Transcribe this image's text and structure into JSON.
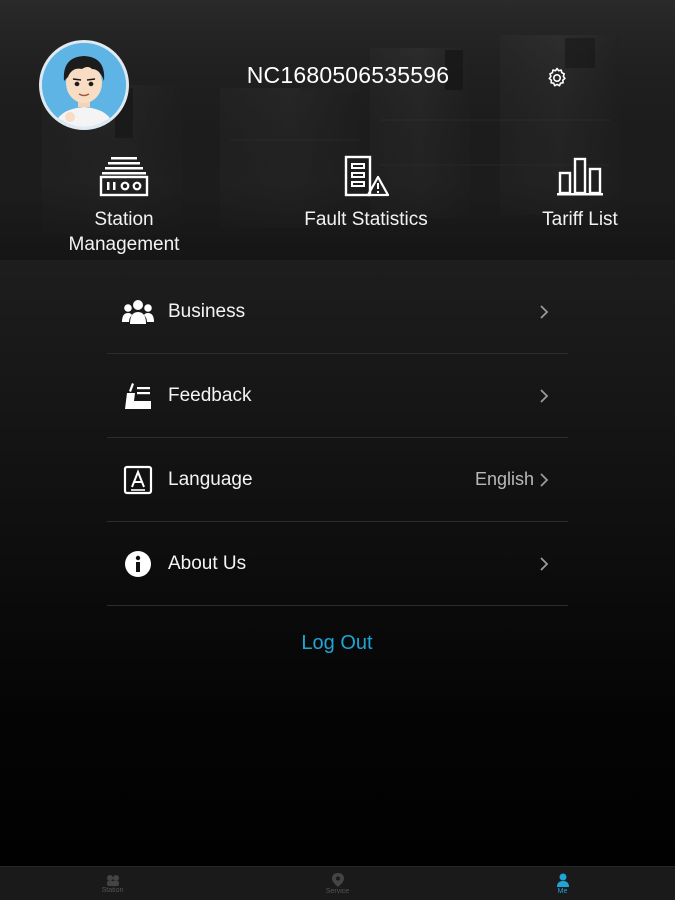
{
  "header": {
    "username": "NC1680506535596",
    "avatar_icon": "avatar-icon",
    "settings_icon": "gear-icon"
  },
  "quick_actions": [
    {
      "label": "Station Management",
      "icon": "station-icon"
    },
    {
      "label": "Fault Statistics",
      "icon": "fault-statistics-icon"
    },
    {
      "label": "Tariff List",
      "icon": "bar-chart-icon"
    }
  ],
  "menu": [
    {
      "label": "Business",
      "icon": "people-icon",
      "value": ""
    },
    {
      "label": "Feedback",
      "icon": "feedback-icon",
      "value": ""
    },
    {
      "label": "Language",
      "icon": "language-icon",
      "value": "English"
    },
    {
      "label": "About Us",
      "icon": "info-icon",
      "value": ""
    }
  ],
  "logout_label": "Log Out",
  "tabbar": [
    {
      "label": "Station",
      "icon": "station-tab-icon",
      "active": false
    },
    {
      "label": "Service",
      "icon": "location-pin-icon",
      "active": false
    },
    {
      "label": "Me",
      "icon": "person-icon",
      "active": true
    }
  ],
  "colors": {
    "accent": "#1ea5d6",
    "background": "#000000",
    "text": "#ffffff",
    "muted": "#b9b9b9"
  }
}
